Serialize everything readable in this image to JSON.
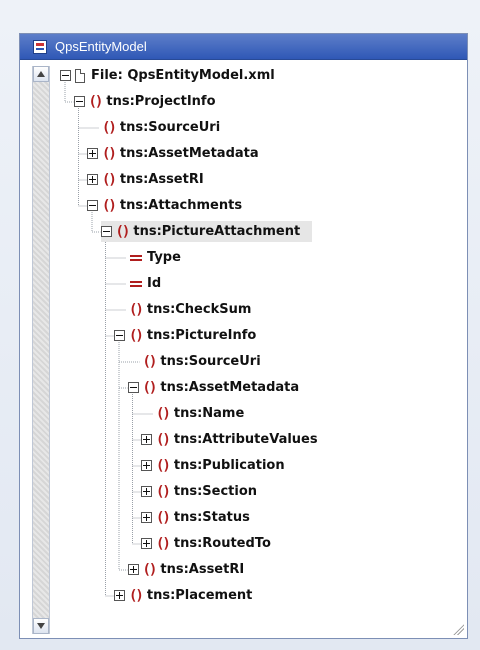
{
  "window": {
    "title": "QpsEntityModel"
  },
  "tree": [
    {
      "label": "File: QpsEntityModel.xml",
      "kind": "file",
      "level": 0,
      "expanded": true
    },
    {
      "label": "tns:ProjectInfo",
      "kind": "element",
      "level": 1,
      "expanded": true
    },
    {
      "label": "tns:SourceUri",
      "kind": "element",
      "level": 2,
      "expanded": null
    },
    {
      "label": "tns:AssetMetadata",
      "kind": "element",
      "level": 2,
      "expanded": false
    },
    {
      "label": "tns:AssetRI",
      "kind": "element",
      "level": 2,
      "expanded": false
    },
    {
      "label": "tns:Attachments",
      "kind": "element",
      "level": 2,
      "expanded": true
    },
    {
      "label": "tns:PictureAttachment",
      "kind": "element",
      "level": 3,
      "expanded": true,
      "selected": true
    },
    {
      "label": "Type",
      "kind": "attribute",
      "level": 4,
      "expanded": null
    },
    {
      "label": "Id",
      "kind": "attribute",
      "level": 4,
      "expanded": null
    },
    {
      "label": "tns:CheckSum",
      "kind": "element",
      "level": 4,
      "expanded": null
    },
    {
      "label": "tns:PictureInfo",
      "kind": "element",
      "level": 4,
      "expanded": true
    },
    {
      "label": "tns:SourceUri",
      "kind": "element",
      "level": 5,
      "expanded": null
    },
    {
      "label": "tns:AssetMetadata",
      "kind": "element",
      "level": 5,
      "expanded": true
    },
    {
      "label": "tns:Name",
      "kind": "element",
      "level": 6,
      "expanded": null
    },
    {
      "label": "tns:AttributeValues",
      "kind": "element",
      "level": 6,
      "expanded": false
    },
    {
      "label": "tns:Publication",
      "kind": "element",
      "level": 6,
      "expanded": false
    },
    {
      "label": "tns:Section",
      "kind": "element",
      "level": 6,
      "expanded": false
    },
    {
      "label": "tns:Status",
      "kind": "element",
      "level": 6,
      "expanded": false
    },
    {
      "label": "tns:RoutedTo",
      "kind": "element",
      "level": 6,
      "expanded": false
    },
    {
      "label": "tns:AssetRI",
      "kind": "element",
      "level": 5,
      "expanded": false
    },
    {
      "label": "tns:Placement",
      "kind": "element",
      "level": 4,
      "expanded": false
    }
  ],
  "icons": {
    "window": "grid-icon",
    "element": "curly-braces-icon",
    "attribute": "equals-icon",
    "file": "file-icon",
    "expand": "plus-box-icon",
    "collapse": "minus-box-icon",
    "connector": "connector-arrow-icon"
  }
}
